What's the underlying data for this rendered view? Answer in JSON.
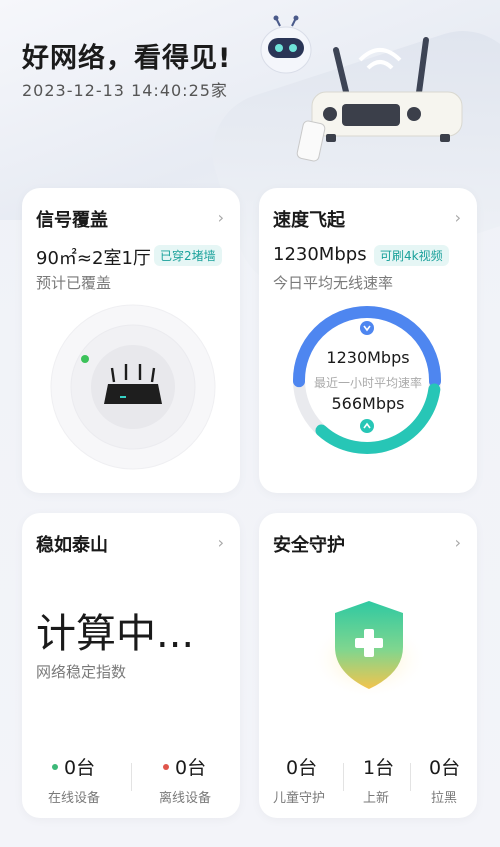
{
  "header": {
    "headline": "好网络，看得见!",
    "timestamp": "2023-12-13 14:40:25家"
  },
  "cards": {
    "coverage": {
      "title": "信号覆盖",
      "area_text": "90㎡≈2室1厅",
      "tag": "已穿2堵墙",
      "subtitle": "预计已覆盖"
    },
    "speed": {
      "title": "速度飞起",
      "speed_text": "1230Mbps",
      "tag": "可刷4k视频",
      "subtitle": "今日平均无线速率",
      "down_value": "1230Mbps",
      "ring_caption": "最近一小时平均速率",
      "up_value": "566Mbps",
      "down_fraction": 0.5,
      "up_fraction": 0.4
    },
    "stability": {
      "title": "稳如泰山",
      "status": "计算中...",
      "subtitle": "网络稳定指数",
      "online_value": "0台",
      "online_label": "在线设备",
      "offline_value": "0台",
      "offline_label": "离线设备"
    },
    "security": {
      "title": "安全守护",
      "child_value": "0台",
      "child_label": "儿童守护",
      "new_value": "1台",
      "new_label": "上新",
      "block_value": "0台",
      "block_label": "拉黑"
    }
  },
  "icons": {
    "chevron": "›"
  },
  "colors": {
    "teal": "#1fc2b4",
    "blue": "#4e86f0",
    "online_dot": "#3cb878",
    "offline_dot": "#e0554b"
  }
}
